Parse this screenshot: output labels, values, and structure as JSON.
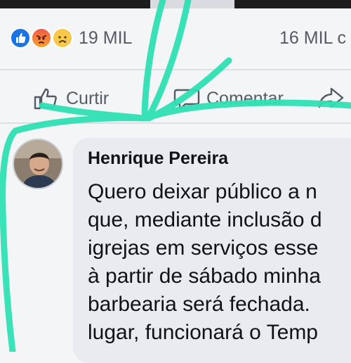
{
  "post_stats": {
    "reaction_icons": [
      "like-icon",
      "angry-icon",
      "sad-icon"
    ],
    "reaction_count": "19 MIL",
    "comment_count": "16 MIL c"
  },
  "actions": {
    "like_label": "Curtir",
    "comment_label": "Comentar"
  },
  "comment": {
    "author": "Henrique Pereira",
    "lines": [
      "Quero deixar público a n",
      "que, mediante inclusão d",
      "igrejas em serviços esse",
      "à partir de sábado minha",
      "barbearia será fechada.",
      "lugar, funcionará o Temp"
    ]
  },
  "colors": {
    "like_blue": "#1b74e4",
    "doodle_teal": "#2fe0b4",
    "text_gray": "#555b64"
  }
}
